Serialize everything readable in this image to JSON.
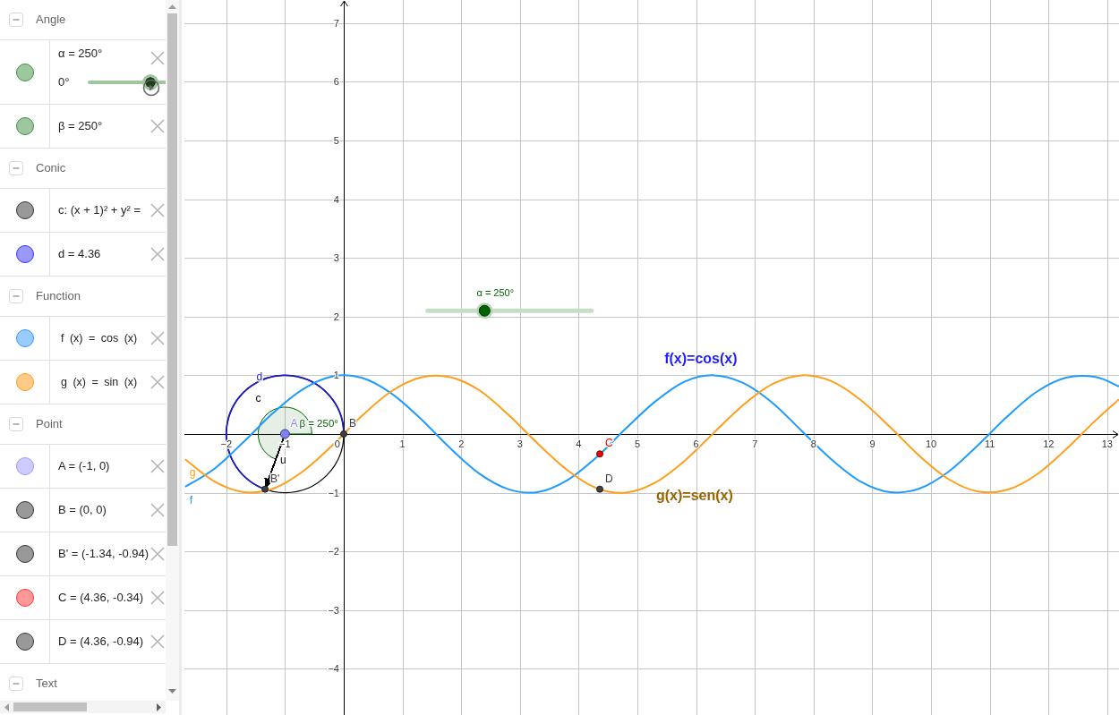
{
  "algebra_view": {
    "groups": [
      {
        "title": "Angle",
        "expanded": true,
        "items": [
          {
            "kind": "slider",
            "text": "α = 250°",
            "color": "#9fc79f",
            "min_label": "0°",
            "level": 0.347
          },
          {
            "kind": "value",
            "text": "β = 250°",
            "color": "#9fc79f"
          }
        ]
      },
      {
        "title": "Conic",
        "expanded": true,
        "items": [
          {
            "kind": "value",
            "text": "c: (x + 1)² + y² =",
            "color": "#999999"
          },
          {
            "kind": "value",
            "text": "d = 4.36",
            "color": "#9999ff"
          }
        ]
      },
      {
        "title": "Function",
        "expanded": true,
        "items": [
          {
            "kind": "function",
            "text": "f (x) = cos (x)",
            "color": "#99ccff"
          },
          {
            "kind": "function",
            "text": "g (x) = sin (x)",
            "color": "#ffcc88"
          }
        ]
      },
      {
        "title": "Point",
        "expanded": true,
        "items": [
          {
            "kind": "value",
            "text": "A = (-1, 0)",
            "color": "#ccccff"
          },
          {
            "kind": "value",
            "text": "B = (0, 0)",
            "color": "#999999"
          },
          {
            "kind": "value",
            "text": "B' = (-1.34, -0.94)",
            "color": "#999999"
          },
          {
            "kind": "value",
            "text": "C = (4.36, -0.34)",
            "color": "#ff9999"
          },
          {
            "kind": "value",
            "text": "D = (4.36, -0.94)",
            "color": "#999999"
          }
        ]
      },
      {
        "title": "Text",
        "expanded": true
      }
    ]
  },
  "graphics_view": {
    "chart_data": {
      "type": "line",
      "grid": true,
      "xlim": [
        -2.713,
        13.2
      ],
      "ylim": [
        -4.787,
        7.393
      ],
      "xticks": [
        {
          "value": -2,
          "label": "−2"
        },
        {
          "value": -1,
          "label": "−1"
        },
        0,
        1,
        2,
        3,
        4,
        5,
        6,
        7,
        8,
        9,
        10,
        11,
        12,
        13
      ],
      "yticks": [
        {
          "value": -4,
          "label": "−4"
        },
        {
          "value": -3,
          "label": "−3"
        },
        {
          "value": -2,
          "label": "−2"
        },
        {
          "value": -1,
          "label": "−1"
        },
        1,
        2,
        3,
        4,
        5,
        6,
        7
      ],
      "x": [
        -2.7,
        -2.2,
        -1.7,
        -1.2,
        -0.7,
        -0.2,
        0.3,
        0.8,
        1.3,
        1.8,
        2.3,
        2.8,
        3.3,
        3.8,
        4.3,
        4.8,
        5.3,
        5.8,
        6.3,
        6.8,
        7.3,
        7.8,
        8.3,
        8.8,
        9.3,
        9.8,
        10.3,
        10.8,
        11.3,
        11.8,
        12.3,
        12.8,
        13.2
      ],
      "series": [
        {
          "name": "f",
          "color": "#1e9bff",
          "values": [
            -0.9,
            -0.59,
            -0.13,
            0.36,
            0.76,
            0.98,
            0.96,
            0.7,
            0.27,
            -0.23,
            -0.67,
            -0.94,
            -0.99,
            -0.79,
            -0.4,
            0.09,
            0.55,
            0.89,
            1,
            0.87,
            0.53,
            0.05,
            -0.43,
            -0.81,
            -0.99,
            -0.93,
            -0.64,
            -0.19,
            0.3,
            0.72,
            0.96,
            0.97,
            0.81
          ]
        },
        {
          "name": "g",
          "color": "#ff9e1a",
          "values": [
            -0.43,
            -0.81,
            -0.99,
            -0.93,
            -0.64,
            -0.2,
            0.3,
            0.72,
            0.96,
            0.97,
            0.75,
            0.33,
            -0.16,
            -0.61,
            -0.92,
            -1,
            -0.83,
            -0.46,
            0.02,
            0.49,
            0.85,
            1,
            0.9,
            0.58,
            0.12,
            -0.37,
            -0.77,
            -0.98,
            -0.95,
            -0.69,
            -0.26,
            0.23,
            0.59
          ]
        }
      ]
    },
    "objects": [
      {
        "kind": "slider",
        "label": "α = 250°",
        "level": 0.347,
        "color": "#006400"
      },
      {
        "kind": "text",
        "text": "f(x)=cos(x)",
        "color": "#1e1eff"
      },
      {
        "kind": "arc",
        "label": "d",
        "color": "#1a1ac8"
      },
      {
        "kind": "circle",
        "label": "c",
        "color": "#000000"
      },
      {
        "kind": "free_point",
        "label": "A",
        "color": "#7f7fff"
      },
      {
        "kind": "angle",
        "label": "β = 250°",
        "color": "#006400"
      },
      {
        "kind": "point",
        "label": "B",
        "color": "#404040"
      },
      {
        "kind": "point",
        "label": "C",
        "color": "#ff0000"
      },
      {
        "kind": "vector",
        "label": "u",
        "color": "#000000"
      },
      {
        "kind": "point",
        "label": "B'",
        "color": "#404040"
      },
      {
        "kind": "point",
        "label": "D",
        "color": "#404040"
      },
      {
        "kind": "text",
        "text": "g(x)=sen(x)",
        "color": "#996600"
      }
    ]
  }
}
